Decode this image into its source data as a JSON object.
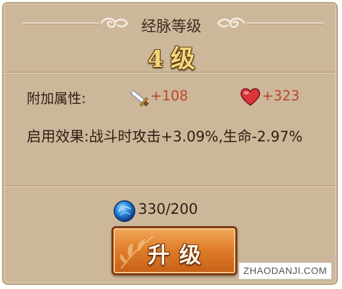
{
  "panel": {
    "title": "经脉等级",
    "level_number": "4",
    "level_unit": "级"
  },
  "attributes": {
    "label": "附加属性:",
    "attack_bonus": "+108",
    "hp_bonus": "+323",
    "attack_icon": "sword-icon",
    "hp_icon": "heart-icon"
  },
  "effect": {
    "text": "启用效果:战斗时攻击+3.09%,生命-2.97%"
  },
  "cost": {
    "icon": "blue-orb-icon",
    "value": "330/200"
  },
  "upgrade_button": {
    "label": "升级"
  },
  "watermark": "ZHAODANJI.COM",
  "colors": {
    "panel_bg": "#cdb79a",
    "bonus_text": "#b9492d",
    "level_gold": "#f4d87a",
    "button_orange": "#e07f2c"
  }
}
